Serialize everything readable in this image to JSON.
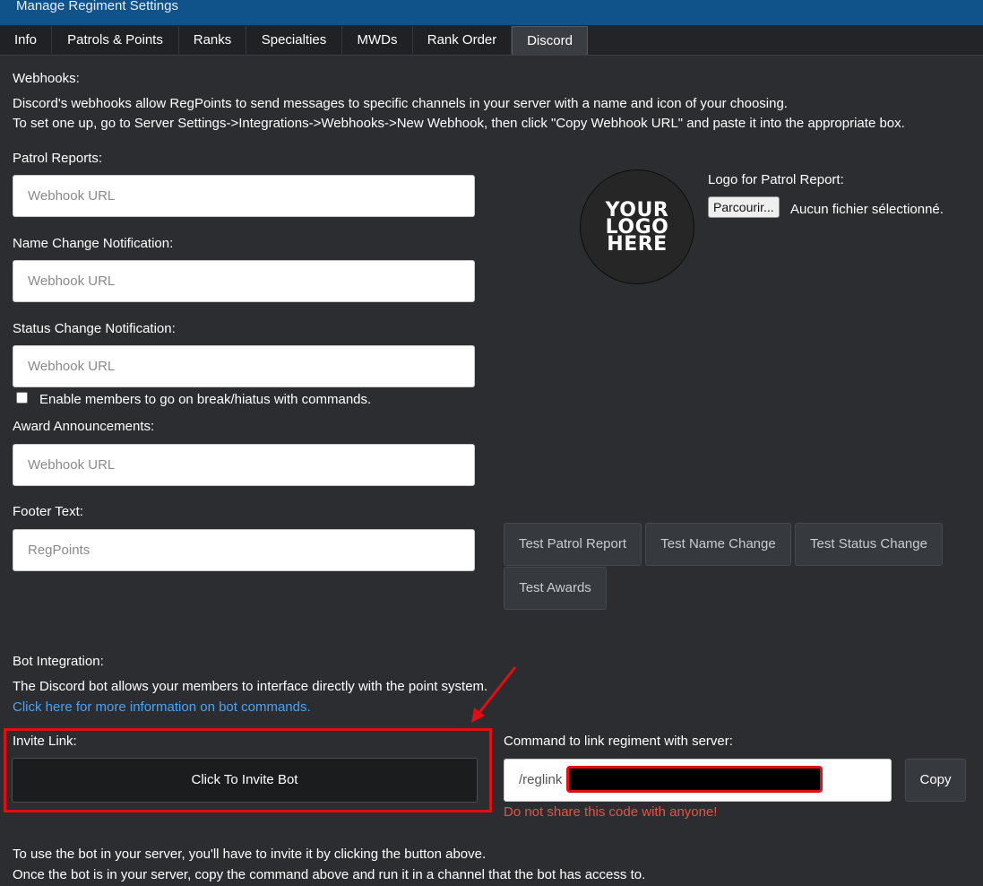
{
  "header": {
    "title": "Manage Regiment Settings"
  },
  "tabs": [
    {
      "label": "Info"
    },
    {
      "label": "Patrols & Points"
    },
    {
      "label": "Ranks"
    },
    {
      "label": "Specialties"
    },
    {
      "label": "MWDs"
    },
    {
      "label": "Rank Order"
    },
    {
      "label": "Discord",
      "active": true
    }
  ],
  "webhooks": {
    "heading": "Webhooks:",
    "desc1": "Discord's webhooks allow RegPoints to send messages to specific channels in your server with a name and icon of your choosing.",
    "desc2": "To set one up, go to Server Settings->Integrations->Webhooks->New Webhook, then click \"Copy Webhook URL\" and paste it into the appropriate box.",
    "patrol_label": "Patrol Reports:",
    "name_change_label": "Name Change Notification:",
    "status_change_label": "Status Change Notification:",
    "break_checkbox_label": "Enable members to go on break/hiatus with commands.",
    "award_label": "Award Announcements:",
    "footer_label": "Footer Text:",
    "placeholder": "Webhook URL",
    "footer_placeholder": "RegPoints"
  },
  "logo": {
    "placeholder_lines": [
      "YOUR",
      "LOGO",
      "HERE"
    ],
    "label": "Logo for Patrol Report:",
    "browse_button": "Parcourir...",
    "no_file": "Aucun fichier sélectionné."
  },
  "test_buttons": {
    "patrol": "Test Patrol Report",
    "name": "Test Name Change",
    "status": "Test Status Change",
    "awards": "Test Awards"
  },
  "bot": {
    "heading": "Bot Integration:",
    "desc": "The Discord bot allows your members to interface directly with the point system.",
    "info_link": "Click here for more information on bot commands.",
    "invite_label": "Invite Link:",
    "invite_button": "Click To Invite Bot",
    "command_label": "Command to link regiment with server:",
    "command_prefix": "/reglink",
    "copy_button": "Copy",
    "warning": "Do not share this code with anyone!",
    "instructions1": "To use the bot in your server, you'll have to invite it by clicking the button above.",
    "instructions2": "Once the bot is in your server, copy the command above and run it in a channel that the bot has access to."
  },
  "colors": {
    "header_bg": "#10528a",
    "page_bg": "#2b2d30",
    "link": "#4ba3f3",
    "warning": "#e5534b",
    "annotation_red": "#e30d12"
  }
}
